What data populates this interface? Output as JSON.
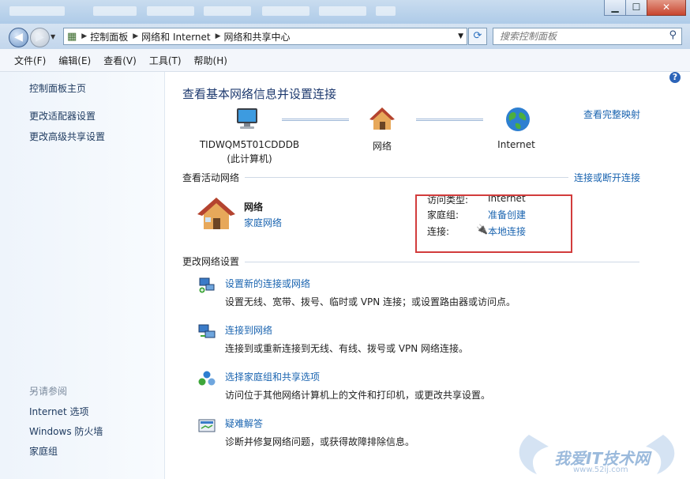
{
  "window": {
    "minimize_label": "▁",
    "maximize_label": "☐",
    "close_label": "✕"
  },
  "address": {
    "segments": [
      "控制面板",
      "网络和 Internet",
      "网络和共享中心"
    ],
    "search_placeholder": "搜索控制面板"
  },
  "menu": [
    "文件(F)",
    "编辑(E)",
    "查看(V)",
    "工具(T)",
    "帮助(H)"
  ],
  "sidebar": {
    "links": [
      "控制面板主页",
      "更改适配器设置",
      "更改高级共享设置"
    ],
    "see_also_heading": "另请参阅",
    "see_also": [
      "Internet 选项",
      "Windows 防火墙",
      "家庭组"
    ]
  },
  "main": {
    "title": "查看基本网络信息并设置连接",
    "full_map_link": "查看完整映射",
    "map": {
      "computer_name": "TIDWQM5T01CDDDB",
      "computer_sub": "(此计算机)",
      "network_label": "网络",
      "internet_label": "Internet"
    },
    "active_heading": "查看活动网络",
    "connect_link": "连接或断开连接",
    "active_network": {
      "name": "网络",
      "type_link": "家庭网络",
      "access_label": "访问类型:",
      "access_value": "Internet",
      "homegroup_label": "家庭组:",
      "homegroup_value": "准备创建",
      "connection_label": "连接:",
      "connection_value": "本地连接"
    },
    "change_heading": "更改网络设置",
    "tasks": [
      {
        "title": "设置新的连接或网络",
        "desc": "设置无线、宽带、拨号、临时或 VPN 连接；或设置路由器或访问点。"
      },
      {
        "title": "连接到网络",
        "desc": "连接到或重新连接到无线、有线、拨号或 VPN 网络连接。"
      },
      {
        "title": "选择家庭组和共享选项",
        "desc": "访问位于其他网络计算机上的文件和打印机，或更改共享设置。"
      },
      {
        "title": "疑难解答",
        "desc": "诊断并修复网络问题，或获得故障排除信息。"
      }
    ]
  },
  "help_label": "?",
  "watermark": {
    "text": "我爱IT技术网",
    "url": "www.52ij.com"
  }
}
